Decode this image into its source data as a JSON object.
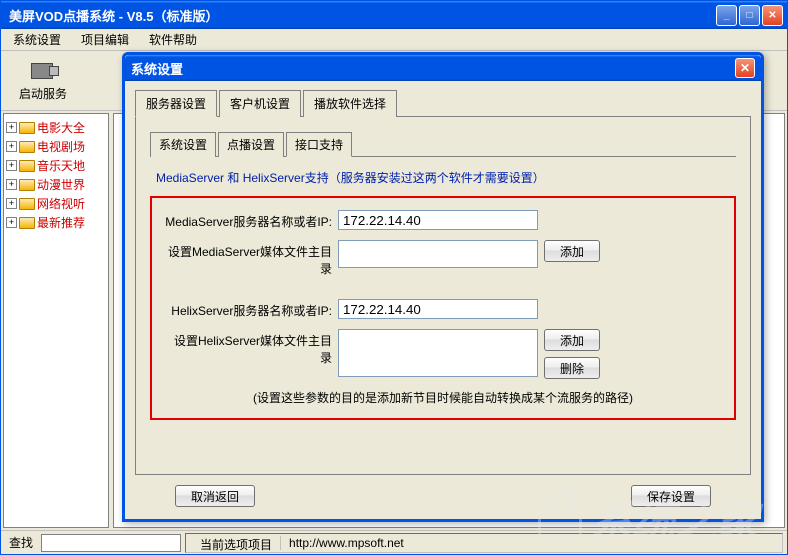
{
  "window": {
    "title": "美屏VOD点播系统 - V8.5（标准版）"
  },
  "menubar": {
    "items": [
      "系统设置",
      "项目编辑",
      "软件帮助"
    ]
  },
  "toolbar": {
    "start_service": "启动服务"
  },
  "sidebar": {
    "items": [
      {
        "label": "电影大全"
      },
      {
        "label": "电视剧场"
      },
      {
        "label": "音乐天地"
      },
      {
        "label": "动漫世界"
      },
      {
        "label": "网络视听"
      },
      {
        "label": "最新推荐"
      }
    ]
  },
  "footer": {
    "search_label": "查找",
    "search_value": "",
    "status_current": "当前选项项目",
    "status_url": "http://www.mpsoft.net"
  },
  "dialog": {
    "title": "系统设置",
    "tabs": [
      "服务器设置",
      "客户机设置",
      "播放软件选择"
    ],
    "subtabs": [
      "系统设置",
      "点播设置",
      "接口支持"
    ],
    "section_title": "MediaServer 和 HelixServer支持（服务器安装过这两个软件才需要设置）",
    "media_ip_label": "MediaServer服务器名称或者IP:",
    "media_ip_value": "172.22.14.40",
    "media_dir_label": "设置MediaServer媒体文件主目录",
    "media_dir_value": "",
    "helix_ip_label": "HelixServer服务器名称或者IP:",
    "helix_ip_value": "172.22.14.40",
    "helix_dir_label": "设置HelixServer媒体文件主目录",
    "helix_dir_value": "",
    "add_btn": "添加",
    "delete_btn": "删除",
    "note": "(设置这些参数的目的是添加新节目时候能自动转换成某个流服务的路径)",
    "cancel_btn": "取消返回",
    "save_btn": "保存设置"
  }
}
